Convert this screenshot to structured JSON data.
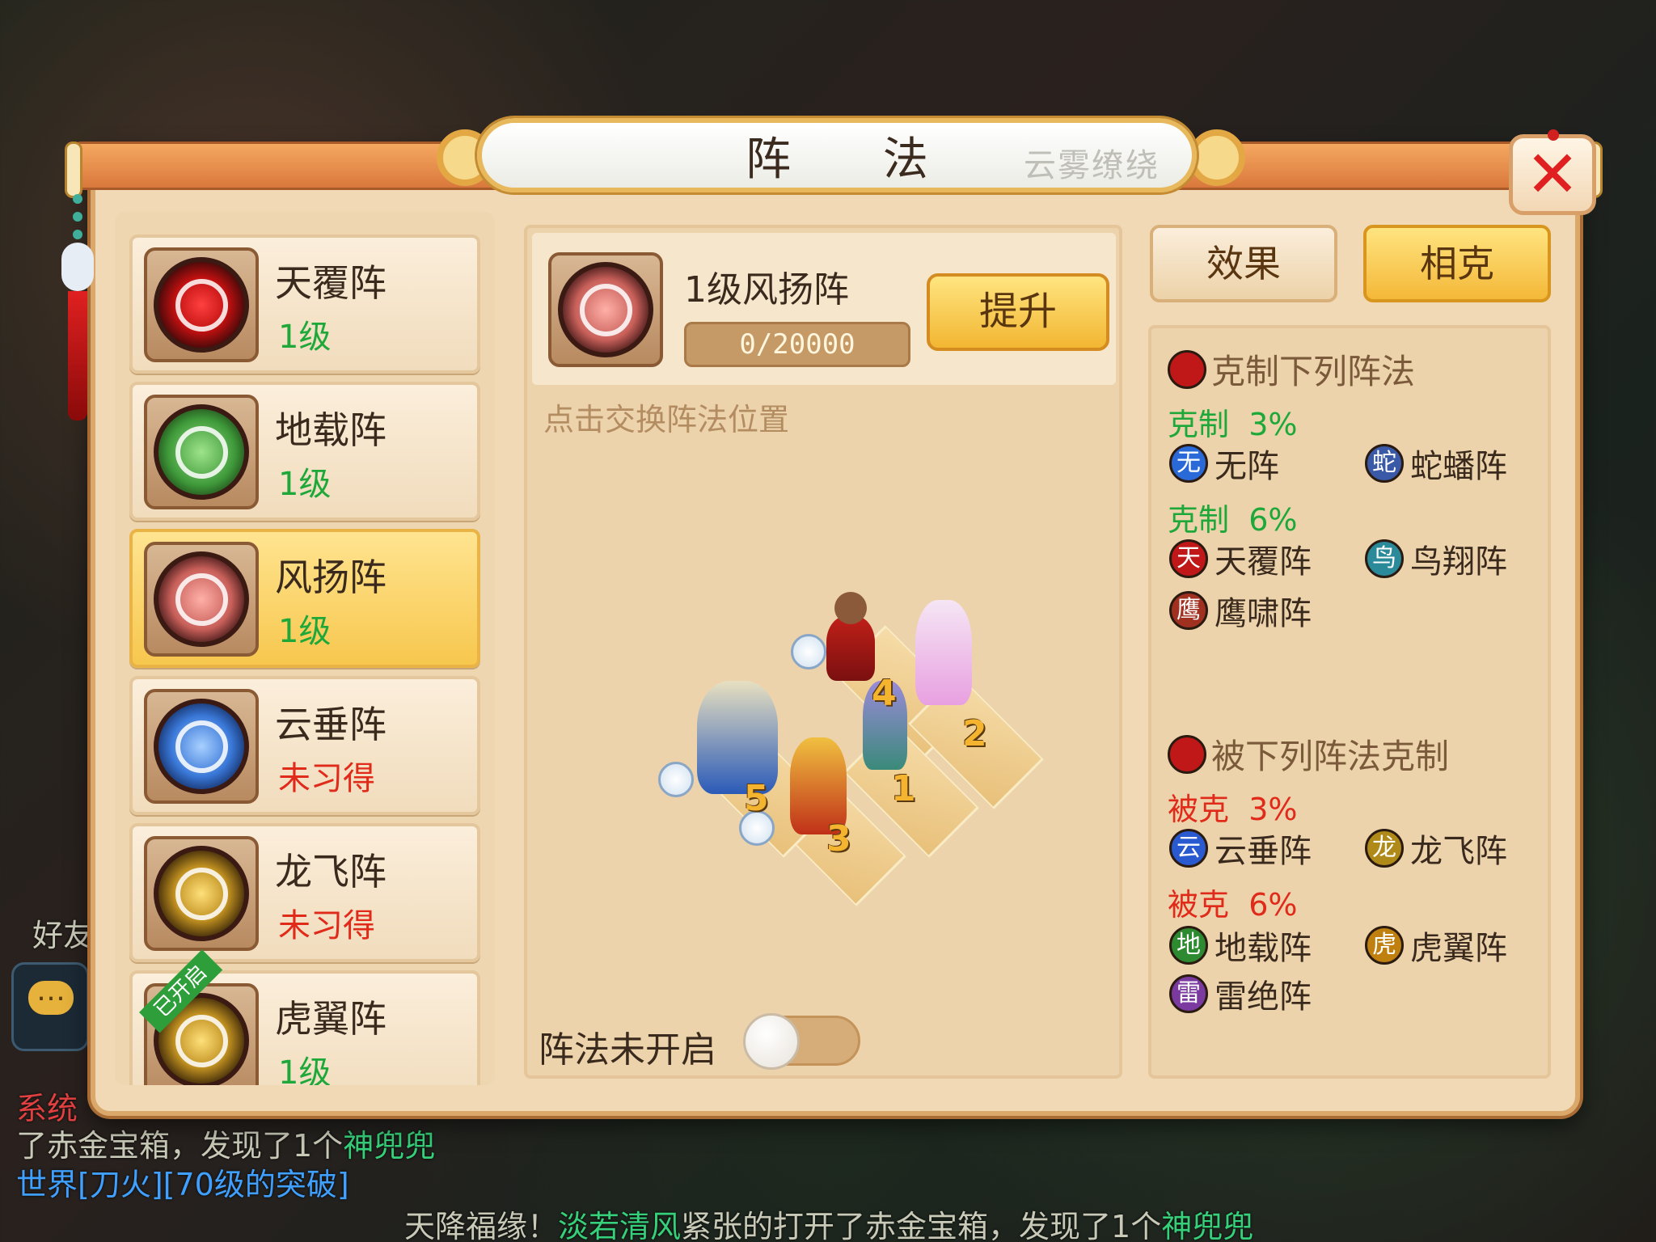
{
  "background": {
    "chat_lines": [
      {
        "prefix": "了赤金宝箱，发现了1个",
        "highlight": "神兜兜"
      },
      {
        "tag": "世界",
        "text": "[刀火][70级的突破]"
      },
      {
        "prefix": "天降福缘！",
        "highlight": "淡若清风",
        "suffix": "紧张的打开了赤金宝箱，发现了1个",
        "highlight2": "神兜兜"
      }
    ],
    "system_tag": "系统",
    "friends_label": "好友"
  },
  "dialog": {
    "title": "阵  法",
    "title_ink": "云雾缭绕"
  },
  "formation_list": [
    {
      "name": "天覆阵",
      "level": "1级",
      "learned": true,
      "selected": false,
      "color": "red",
      "icon": "tianfu-formation-icon"
    },
    {
      "name": "地载阵",
      "level": "1级",
      "learned": true,
      "selected": false,
      "color": "green",
      "icon": "dizai-formation-icon"
    },
    {
      "name": "风扬阵",
      "level": "1级",
      "learned": true,
      "selected": true,
      "color": "pink",
      "icon": "fengyang-formation-icon"
    },
    {
      "name": "云垂阵",
      "level": "未习得",
      "learned": false,
      "selected": false,
      "color": "blue",
      "icon": "yunchui-formation-icon"
    },
    {
      "name": "龙飞阵",
      "level": "未习得",
      "learned": false,
      "selected": false,
      "color": "gold",
      "icon": "longfei-formation-icon"
    },
    {
      "name": "虎翼阵",
      "level": "1级",
      "learned": true,
      "selected": false,
      "color": "gold",
      "icon": "huyi-formation-icon",
      "ribbon": "已开启"
    }
  ],
  "current": {
    "name": "1级风扬阵",
    "progress_text": "0/20000",
    "progress_fraction": 0.0,
    "upgrade_label": "提升",
    "hint": "点击交换阵法位置",
    "slots": [
      "1",
      "2",
      "3",
      "4",
      "5"
    ],
    "toggle_label": "阵法未开启",
    "toggle_on": false
  },
  "tabs": {
    "effect_label": "效果",
    "counter_label": "相克"
  },
  "counter": {
    "beats_title": "克制下列阵法",
    "beats_groups": [
      {
        "label": "克制",
        "pct": "3%",
        "items": [
          {
            "name": "无阵",
            "glyph": "无",
            "color": "#2a6ad8"
          },
          {
            "name": "蛇蟠阵",
            "glyph": "蛇",
            "color": "#3a5aa8"
          }
        ]
      },
      {
        "label": "克制",
        "pct": "6%",
        "items": [
          {
            "name": "天覆阵",
            "glyph": "天",
            "color": "#c01818"
          },
          {
            "name": "鸟翔阵",
            "glyph": "鸟",
            "color": "#2a8a9a"
          },
          {
            "name": "鹰啸阵",
            "glyph": "鹰",
            "color": "#a03020"
          }
        ]
      }
    ],
    "beaten_title": "被下列阵法克制",
    "beaten_groups": [
      {
        "label": "被克",
        "pct": "3%",
        "items": [
          {
            "name": "云垂阵",
            "glyph": "云",
            "color": "#2a5ad0"
          },
          {
            "name": "龙飞阵",
            "glyph": "龙",
            "color": "#b08a18"
          }
        ]
      },
      {
        "label": "被克",
        "pct": "6%",
        "items": [
          {
            "name": "地载阵",
            "glyph": "地",
            "color": "#2e8a30"
          },
          {
            "name": "虎翼阵",
            "glyph": "虎",
            "color": "#c08010"
          },
          {
            "name": "雷绝阵",
            "glyph": "雷",
            "color": "#7a3aa0"
          }
        ]
      }
    ]
  },
  "colors": {
    "accent_gold": "#f4b838",
    "win_green": "#1ea83a",
    "lose_red": "#e02a1a"
  }
}
